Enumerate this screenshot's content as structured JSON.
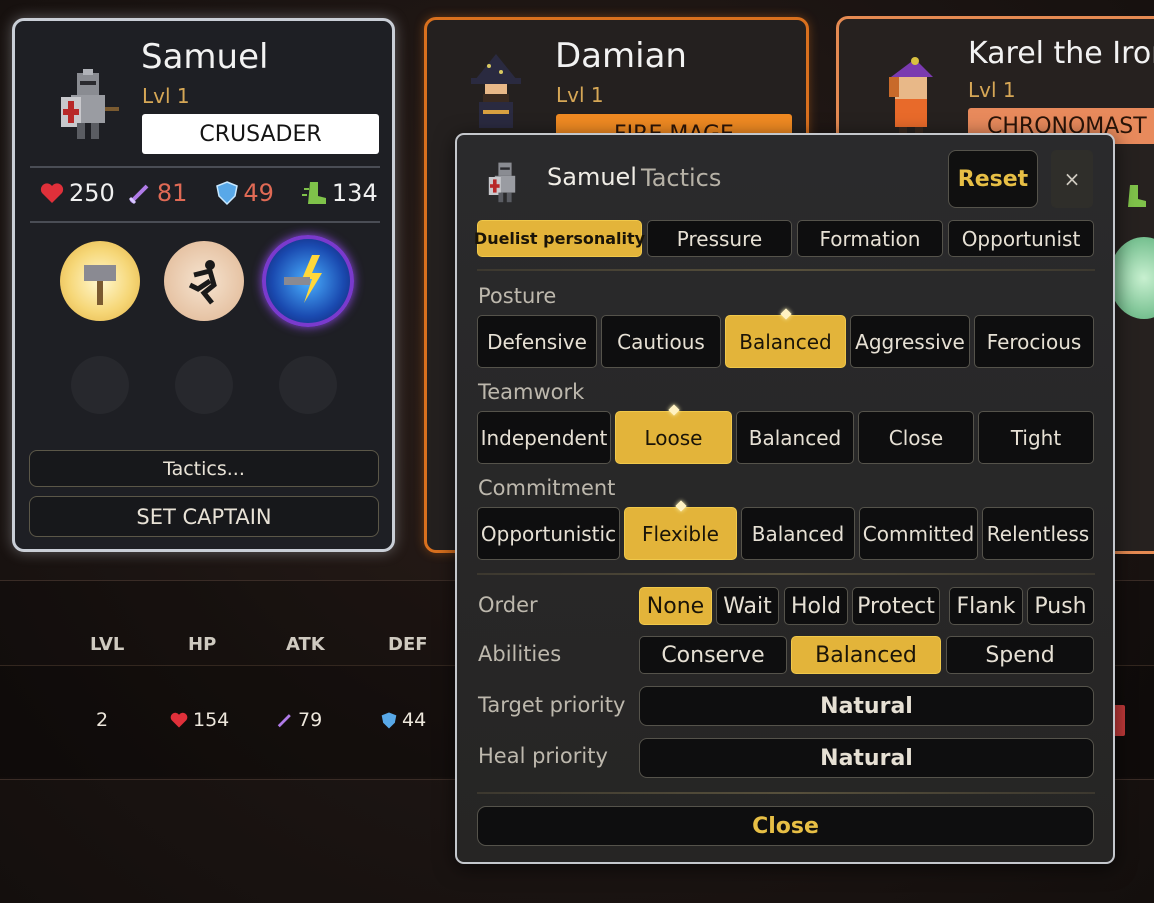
{
  "heroes": [
    {
      "name": "Samuel",
      "level": "Lvl 1",
      "class": "CRUSADER",
      "hp": "250",
      "atk": "81",
      "def": "49",
      "spd": "134",
      "tactics_label": "Tactics...",
      "captain_label": "SET CAPTAIN"
    },
    {
      "name": "Damian",
      "level": "Lvl 1",
      "class": "FIRE MAGE"
    },
    {
      "name": "Karel the Ironv",
      "level": "Lvl 1",
      "class": "CHRONOMAST"
    }
  ],
  "table": {
    "headers": [
      "LVL",
      "HP",
      "ATK",
      "DEF"
    ],
    "row": {
      "lvl": "2",
      "hp": "154",
      "atk": "79",
      "def": "44"
    }
  },
  "tactics": {
    "hero_name": "Samuel",
    "title": "Tactics",
    "reset_label": "Reset",
    "close_x": "×",
    "presets": [
      "Duelist personality",
      "Pressure",
      "Formation",
      "Opportunist"
    ],
    "posture": {
      "label": "Posture",
      "options": [
        "Defensive",
        "Cautious",
        "Balanced",
        "Aggressive",
        "Ferocious"
      ],
      "selected": "Balanced"
    },
    "teamwork": {
      "label": "Teamwork",
      "options": [
        "Independent",
        "Loose",
        "Balanced",
        "Close",
        "Tight"
      ],
      "selected": "Loose"
    },
    "commitment": {
      "label": "Commitment",
      "options": [
        "Opportunistic",
        "Flexible",
        "Balanced",
        "Committed",
        "Relentless"
      ],
      "selected": "Flexible"
    },
    "order": {
      "label": "Order",
      "options": [
        "None",
        "Wait",
        "Hold",
        "Protect",
        "Flank",
        "Push"
      ],
      "selected": "None"
    },
    "abilities": {
      "label": "Abilities",
      "options": [
        "Conserve",
        "Balanced",
        "Spend"
      ],
      "selected": "Balanced"
    },
    "target_priority": {
      "label": "Target priority",
      "value": "Natural"
    },
    "heal_priority": {
      "label": "Heal priority",
      "value": "Natural"
    },
    "close_label": "Close"
  },
  "colors": {
    "accent": "#e3b43a",
    "hp": "#e0303a",
    "atk": "#b07be8",
    "def": "#58a8e8",
    "spd": "#7fc24a",
    "stat_red": "#e06a55"
  },
  "icons": [
    "heart-icon",
    "sword-icon",
    "shield-icon",
    "boot-icon",
    "hammer-ability-icon",
    "sprint-ability-icon",
    "lightning-hammer-ability-icon"
  ]
}
